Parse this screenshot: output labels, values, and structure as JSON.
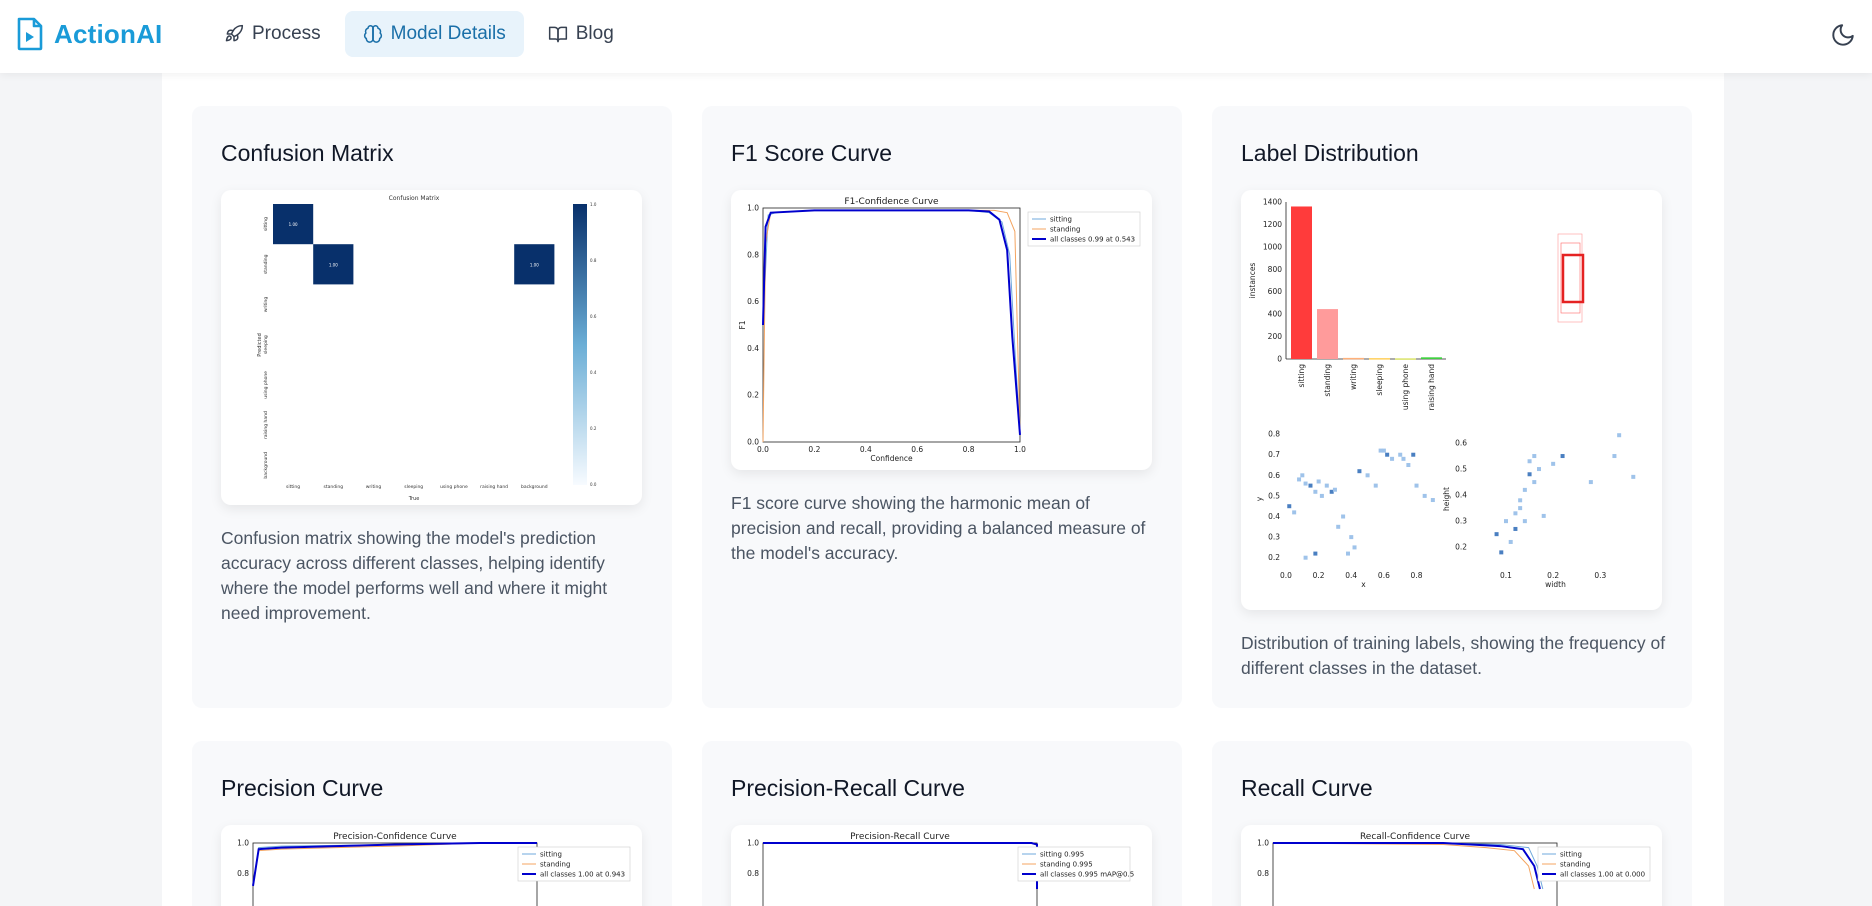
{
  "app": {
    "name": "ActionAI"
  },
  "nav": {
    "items": [
      {
        "label": "Process",
        "icon": "rocket-icon"
      },
      {
        "label": "Model Details",
        "icon": "brain-icon",
        "active": true
      },
      {
        "label": "Blog",
        "icon": "book-icon"
      }
    ]
  },
  "theme": {
    "icon": "moon-icon"
  },
  "cards": [
    {
      "title": "Confusion Matrix",
      "description": "Confusion matrix showing the model's prediction accuracy across different classes, helping identify where the model performs well and where it might need improvement."
    },
    {
      "title": "F1 Score Curve",
      "description": "F1 score curve showing the harmonic mean of precision and recall, providing a balanced measure of the model's accuracy."
    },
    {
      "title": "Label Distribution",
      "description": "Distribution of training labels, showing the frequency of different classes in the dataset."
    },
    {
      "title": "Precision Curve"
    },
    {
      "title": "Precision-Recall Curve"
    },
    {
      "title": "Recall Curve"
    }
  ],
  "colors": {
    "brand": "#1a9bd8",
    "sitting": "#6fa8dc",
    "standing": "#f4a460",
    "all": "#0000cd",
    "cm": "#08306b",
    "bar_sitting": "#ff3b3b",
    "bar_standing": "#ff9b9b"
  },
  "chart_data": [
    {
      "type": "heatmap",
      "title": "Confusion Matrix",
      "xlabel": "True",
      "ylabel": "Predicted",
      "classes": [
        "sitting",
        "standing",
        "writing",
        "sleeping",
        "using phone",
        "raising hand",
        "background"
      ],
      "cells": [
        {
          "row": "sitting",
          "col": "sitting",
          "value": 1.0
        },
        {
          "row": "standing",
          "col": "standing",
          "value": 1.0
        },
        {
          "row": "standing",
          "col": "background",
          "value": 1.0
        }
      ],
      "colorbar_ticks": [
        "1.0",
        "0.8",
        "0.6",
        "0.4",
        "0.2",
        "0.0"
      ]
    },
    {
      "type": "line",
      "title": "F1-Confidence Curve",
      "xlabel": "Confidence",
      "ylabel": "F1",
      "xlim": [
        0,
        1
      ],
      "ylim": [
        0,
        1
      ],
      "x_ticks": [
        "0.0",
        "0.2",
        "0.4",
        "0.6",
        "0.8",
        "1.0"
      ],
      "y_ticks": [
        "0.0",
        "0.2",
        "0.4",
        "0.6",
        "0.8",
        "1.0"
      ],
      "legend": [
        "sitting",
        "standing",
        "all classes 0.99 at 0.543"
      ],
      "series": [
        {
          "name": "sitting",
          "x": [
            0.0,
            0.02,
            0.05,
            0.2,
            0.5,
            0.8,
            0.88,
            0.93,
            0.96,
            0.98,
            1.0
          ],
          "y": [
            0.5,
            0.97,
            0.98,
            0.99,
            0.99,
            0.99,
            0.98,
            0.94,
            0.8,
            0.4,
            0.03
          ]
        },
        {
          "name": "standing",
          "x": [
            0.0,
            0.01,
            0.03,
            0.2,
            0.5,
            0.8,
            0.9,
            0.95,
            0.98,
            1.0
          ],
          "y": [
            0.0,
            0.85,
            0.98,
            0.99,
            0.99,
            0.99,
            0.99,
            0.98,
            0.9,
            0.03
          ]
        },
        {
          "name": "all classes 0.99 at 0.543",
          "x": [
            0.0,
            0.01,
            0.03,
            0.2,
            0.5,
            0.8,
            0.88,
            0.92,
            0.95,
            0.97,
            1.0
          ],
          "y": [
            0.5,
            0.92,
            0.98,
            0.99,
            0.99,
            0.99,
            0.985,
            0.95,
            0.82,
            0.45,
            0.03
          ]
        }
      ]
    },
    {
      "type": "bar",
      "title": "",
      "ylabel": "instances",
      "categories": [
        "sitting",
        "standing",
        "writing",
        "sleeping",
        "using phone",
        "raising hand"
      ],
      "values": [
        1360,
        445,
        10,
        8,
        6,
        15
      ],
      "ylim": [
        0,
        1400
      ],
      "y_ticks": [
        "0",
        "200",
        "400",
        "600",
        "800",
        "1000",
        "1200",
        "1400"
      ]
    },
    {
      "type": "scatter",
      "title": "",
      "xlabel": "x",
      "ylabel": "y",
      "x_ticks": [
        "0.0",
        "0.2",
        "0.4",
        "0.6",
        "0.8"
      ],
      "y_ticks": [
        "0.2",
        "0.3",
        "0.4",
        "0.5",
        "0.6",
        "0.7",
        "0.8"
      ],
      "x": [
        0.02,
        0.05,
        0.08,
        0.1,
        0.12,
        0.15,
        0.18,
        0.2,
        0.22,
        0.25,
        0.28,
        0.3,
        0.35,
        0.38,
        0.4,
        0.45,
        0.5,
        0.55,
        0.58,
        0.6,
        0.62,
        0.65,
        0.7,
        0.72,
        0.75,
        0.78,
        0.8,
        0.85,
        0.9,
        0.12,
        0.18,
        0.32,
        0.42
      ],
      "y": [
        0.45,
        0.42,
        0.58,
        0.6,
        0.56,
        0.55,
        0.52,
        0.57,
        0.5,
        0.55,
        0.52,
        0.53,
        0.4,
        0.22,
        0.3,
        0.62,
        0.6,
        0.55,
        0.72,
        0.72,
        0.7,
        0.68,
        0.7,
        0.68,
        0.65,
        0.7,
        0.55,
        0.5,
        0.48,
        0.2,
        0.22,
        0.35,
        0.25
      ]
    },
    {
      "type": "scatter",
      "title": "",
      "xlabel": "width",
      "ylabel": "height",
      "x_ticks": [
        "0.1",
        "0.2",
        "0.3"
      ],
      "y_ticks": [
        "0.2",
        "0.3",
        "0.4",
        "0.5",
        "0.6"
      ],
      "x": [
        0.08,
        0.1,
        0.12,
        0.13,
        0.14,
        0.15,
        0.15,
        0.16,
        0.17,
        0.18,
        0.12,
        0.11,
        0.14,
        0.16,
        0.2,
        0.22,
        0.28,
        0.33,
        0.34,
        0.37,
        0.09,
        0.13
      ],
      "y": [
        0.25,
        0.3,
        0.33,
        0.38,
        0.42,
        0.48,
        0.53,
        0.55,
        0.5,
        0.32,
        0.27,
        0.22,
        0.3,
        0.45,
        0.52,
        0.55,
        0.45,
        0.55,
        0.63,
        0.47,
        0.18,
        0.35
      ]
    },
    {
      "type": "line",
      "title": "Precision-Confidence Curve",
      "x_ticks": [],
      "y_ticks": [
        "0.8",
        "1.0"
      ],
      "ylim": [
        0.7,
        1.0
      ],
      "legend": [
        "sitting",
        "standing",
        "all classes 1.00 at 0.943"
      ],
      "series": [
        {
          "name": "sitting",
          "x": [
            0.0,
            0.02,
            0.1,
            0.5,
            0.8,
            1.0
          ],
          "y": [
            0.72,
            0.97,
            0.98,
            0.99,
            1.0,
            1.0
          ]
        },
        {
          "name": "standing",
          "x": [
            0.0,
            0.02,
            0.1,
            0.5,
            0.8,
            1.0
          ],
          "y": [
            0.72,
            0.95,
            0.96,
            0.98,
            1.0,
            1.0
          ]
        },
        {
          "name": "all classes 1.00 at 0.943",
          "x": [
            0.0,
            0.02,
            0.1,
            0.5,
            0.8,
            1.0
          ],
          "y": [
            0.72,
            0.96,
            0.97,
            0.99,
            1.0,
            1.0
          ]
        }
      ]
    },
    {
      "type": "line",
      "title": "Precision-Recall Curve",
      "x_ticks": [],
      "y_ticks": [
        "0.8",
        "1.0"
      ],
      "ylim": [
        0.7,
        1.0
      ],
      "legend": [
        "sitting 0.995",
        "standing 0.995",
        "all classes 0.995 mAP@0.5"
      ],
      "series": [
        {
          "name": "sitting 0.995",
          "x": [
            0.0,
            0.98,
            1.0,
            1.0
          ],
          "y": [
            1.0,
            1.0,
            0.99,
            0.7
          ]
        },
        {
          "name": "standing 0.995",
          "x": [
            0.0,
            0.98,
            1.0,
            1.0
          ],
          "y": [
            1.0,
            1.0,
            0.99,
            0.7
          ]
        },
        {
          "name": "all classes 0.995 mAP@0.5",
          "x": [
            0.0,
            0.98,
            1.0,
            1.0
          ],
          "y": [
            1.0,
            1.0,
            0.99,
            0.7
          ]
        }
      ]
    },
    {
      "type": "line",
      "title": "Recall-Confidence Curve",
      "x_ticks": [],
      "y_ticks": [
        "0.8",
        "1.0"
      ],
      "ylim": [
        0.7,
        1.0
      ],
      "legend": [
        "sitting",
        "standing",
        "all classes 1.00 at 0.000"
      ],
      "series": [
        {
          "name": "sitting",
          "x": [
            0.0,
            0.6,
            0.8,
            0.9,
            0.93,
            0.95
          ],
          "y": [
            1.0,
            1.0,
            0.99,
            0.97,
            0.85,
            0.7
          ]
        },
        {
          "name": "standing",
          "x": [
            0.0,
            0.6,
            0.75,
            0.85,
            0.9,
            0.92
          ],
          "y": [
            1.0,
            0.99,
            0.97,
            0.95,
            0.85,
            0.7
          ]
        },
        {
          "name": "all classes 1.00 at 0.000",
          "x": [
            0.0,
            0.6,
            0.8,
            0.88,
            0.92,
            0.94
          ],
          "y": [
            1.0,
            1.0,
            0.98,
            0.96,
            0.85,
            0.7
          ]
        }
      ]
    }
  ]
}
